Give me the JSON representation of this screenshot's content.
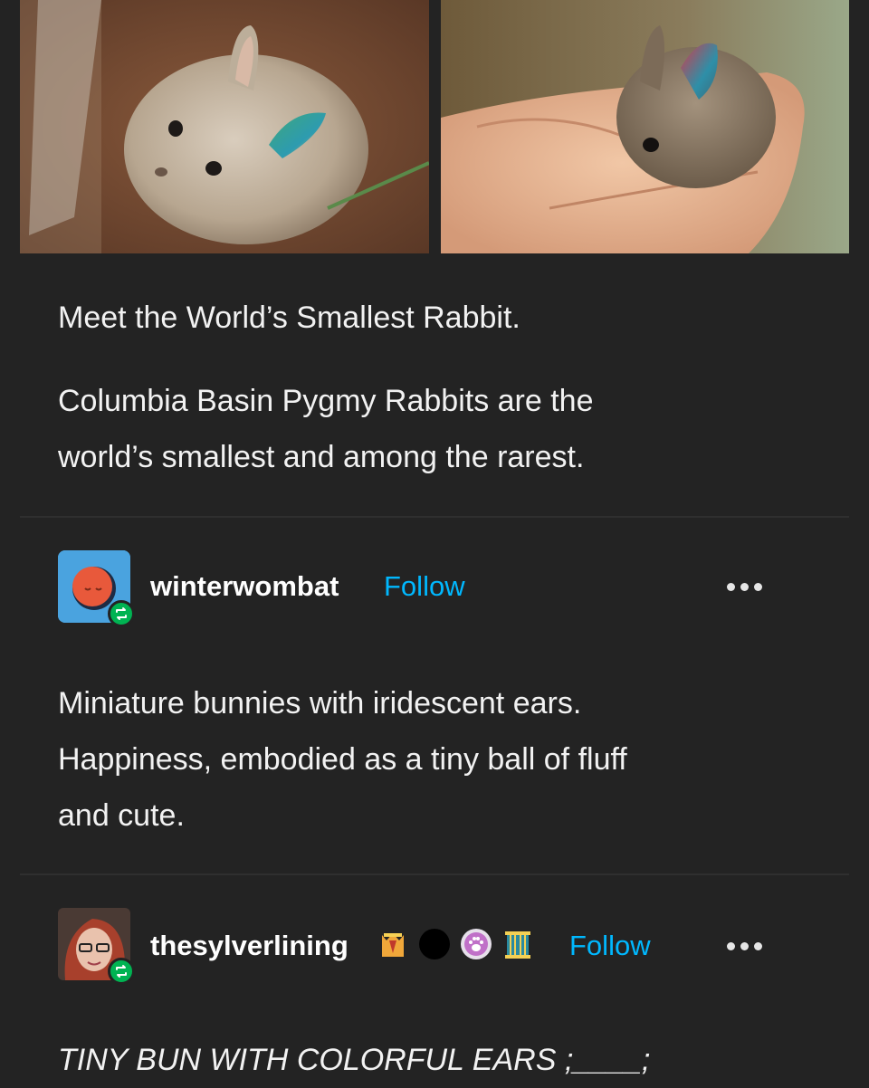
{
  "original_post": {
    "images": [
      {
        "icon": "rabbit-photo-left"
      },
      {
        "icon": "rabbit-in-hand-photo-right"
      }
    ],
    "title": "Meet the World’s Smallest Rabbit.",
    "text_line1": "Columbia Basin Pygmy Rabbits are the",
    "text_line2": "world’s smallest and among the rarest."
  },
  "reblogs": [
    {
      "username": "winterwombat",
      "follow_label": "Follow",
      "avatar_color": "#e8593b",
      "avatar_bg": "#4aa3df",
      "text_line1": "Miniature bunnies with iridescent ears.",
      "text_line2": "Happiness, embodied as a tiny ball of fluff",
      "text_line3": "and cute."
    },
    {
      "username": "thesylverlining",
      "follow_label": "Follow",
      "badges": [
        "crown-vest-badge",
        "black-circle-badge",
        "paw-badge",
        "cage-badge"
      ],
      "text_line1": "TINY BUN WITH COLORFUL EARS ;____;"
    }
  ],
  "colors": {
    "background": "#232323",
    "follow": "#00b8ff",
    "reblog_badge": "#00b352"
  }
}
